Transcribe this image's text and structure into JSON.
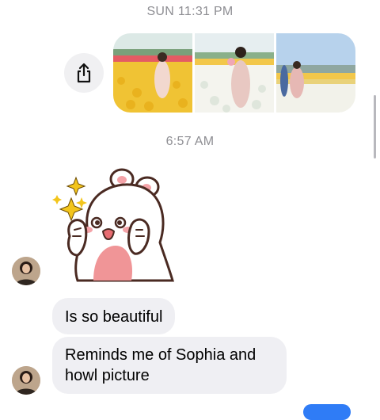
{
  "thread": {
    "timestamp_1": "SUN 11:31 PM",
    "timestamp_2": "6:57 AM"
  },
  "attachments": {
    "share_icon": "share-icon",
    "photos": [
      {
        "name": "tulip-photo-yellow",
        "icon": "photo"
      },
      {
        "name": "tulip-photo-white",
        "icon": "photo"
      },
      {
        "name": "tulip-photo-couple",
        "icon": "photo"
      }
    ]
  },
  "sticker": {
    "icon": "bear-sticker-icon"
  },
  "messages": [
    {
      "text": "Is so beautiful"
    },
    {
      "text": "Reminds me of Sophia and howl picture"
    }
  ],
  "colors": {
    "incoming_bubble": "#efeff3",
    "outgoing_bubble": "#2f7cf6",
    "timestamp": "#8e8e93"
  }
}
